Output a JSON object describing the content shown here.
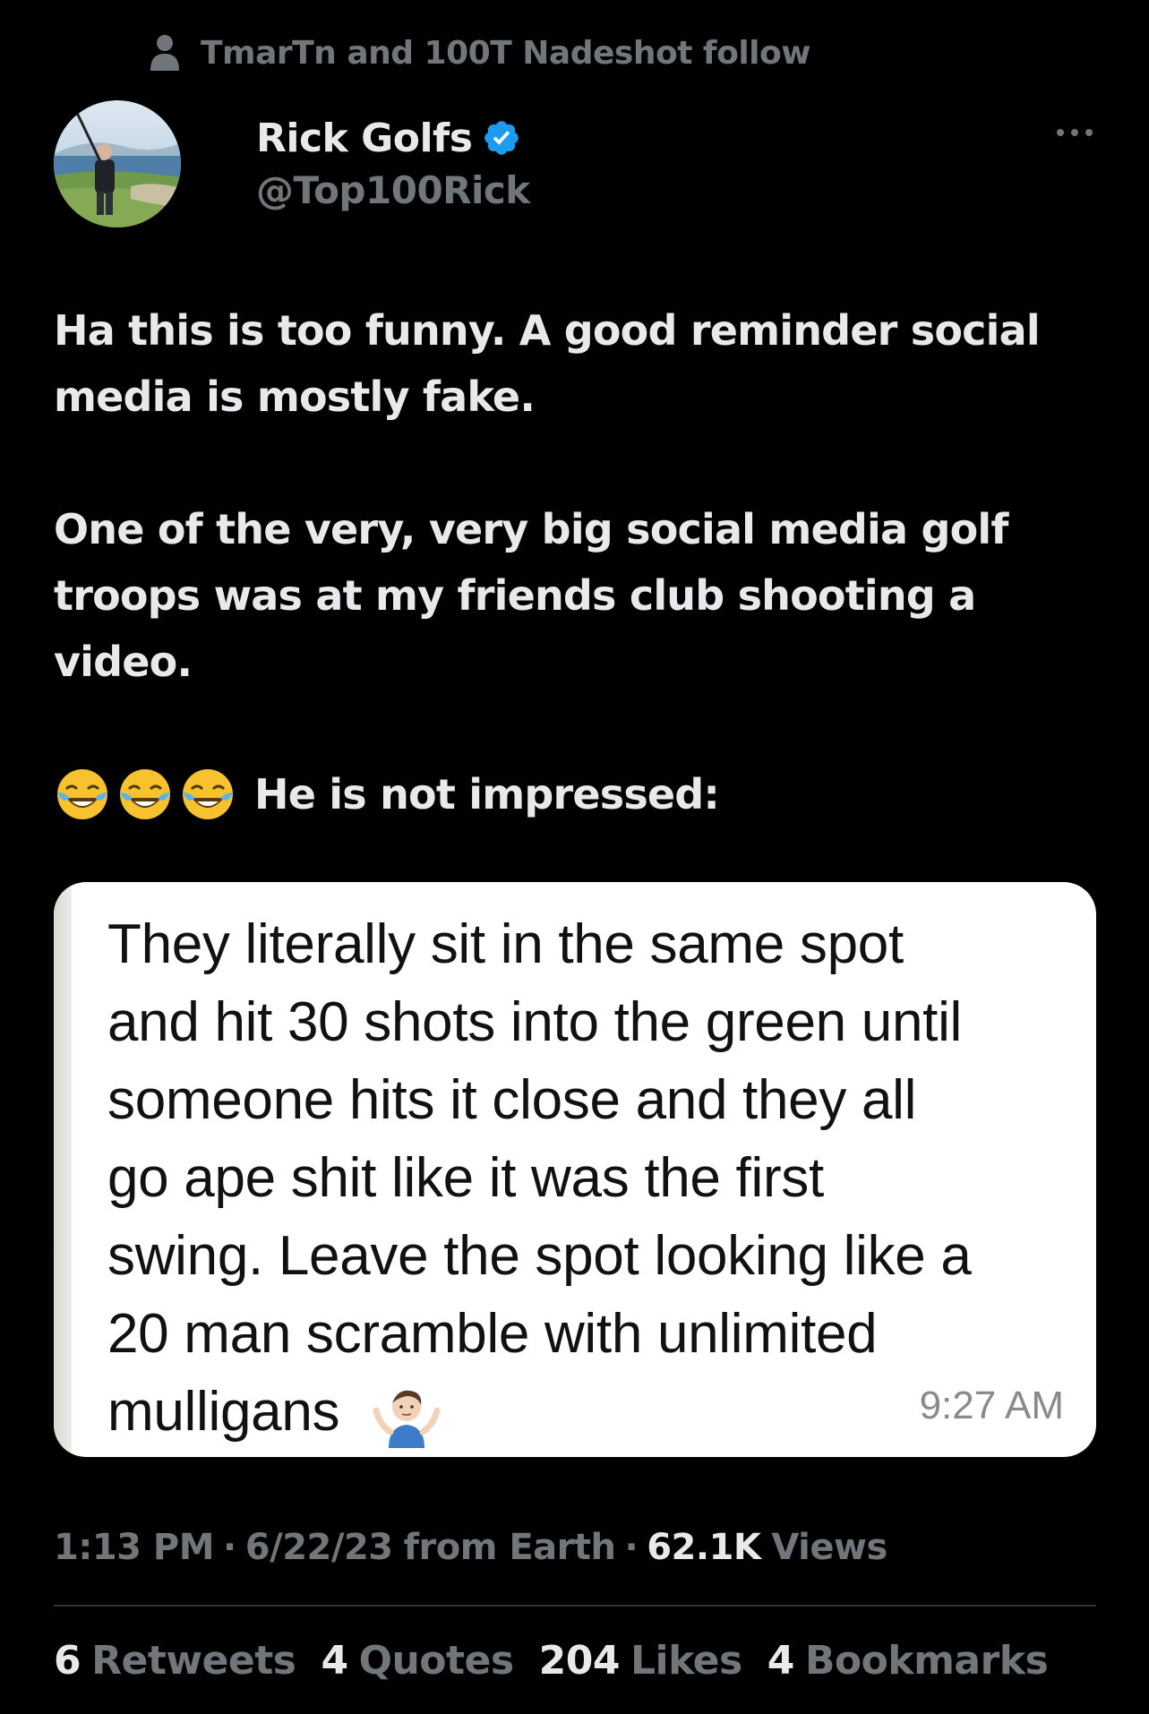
{
  "social_context": {
    "icon": "person-icon",
    "text": "TmarTn and 100T Nadeshot follow"
  },
  "author": {
    "display_name": "Rick Golfs",
    "handle": "@Top100Rick",
    "verified": true,
    "verified_color": "#1d9bf0",
    "more_icon": "more-horizontal-icon"
  },
  "tweet": {
    "paragraph_1": "Ha this is too funny. A good reminder social media is mostly fake.",
    "paragraph_2": "One of the very, very big social media golf troops was at my friends club shooting a video.",
    "paragraph_3_emoji": "😂😂😂",
    "paragraph_3_text": "He is not impressed:"
  },
  "embedded_message": {
    "lines": [
      "They literally sit in the same spot",
      "and hit 30 shots into the green until",
      "someone hits it close and they all",
      "go ape shit like it was the first",
      "swing. Leave the spot looking like a",
      "20 man scramble with unlimited",
      "mulligans"
    ],
    "trailing_emoji": "🤷‍♂️",
    "time": "9:27 AM"
  },
  "meta": {
    "time": "1:13 PM",
    "date": "6/22/23",
    "source": "from Earth",
    "views_count": "62.1K",
    "views_label": "Views",
    "separator": "·"
  },
  "stats": {
    "retweets": {
      "count": "6",
      "label": "Retweets"
    },
    "quotes": {
      "count": "4",
      "label": "Quotes"
    },
    "likes": {
      "count": "204",
      "label": "Likes"
    },
    "bookmarks": {
      "count": "4",
      "label": "Bookmarks"
    }
  },
  "colors": {
    "background": "#000000",
    "primary_text": "#e7e9ea",
    "secondary_text": "#71767b",
    "divider": "#2f3336",
    "card_background": "#ffffff"
  }
}
